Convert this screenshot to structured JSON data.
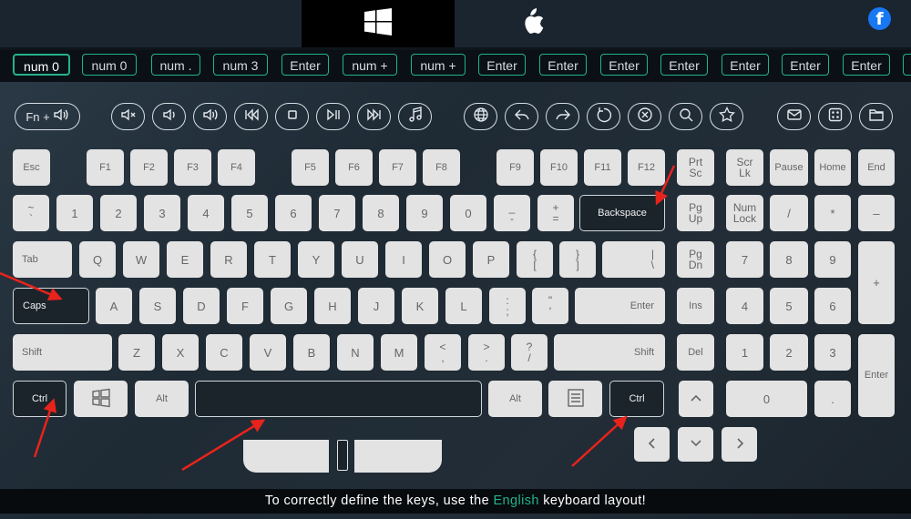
{
  "top_tabs": {
    "windows": {
      "icon": "windows-logo-icon"
    },
    "mac": {
      "icon": "apple-logo-icon"
    },
    "social": {
      "icon": "facebook-icon",
      "text": "f"
    }
  },
  "history_strip": [
    "num 0",
    "num 0",
    "num .",
    "num 3",
    "Enter",
    "num +",
    "num +",
    "Enter",
    "Enter",
    "Enter",
    "Enter",
    "Enter",
    "Enter",
    "Enter"
  ],
  "media_buttons": [
    {
      "name": "fn-volume-button",
      "icon": "speaker-icon",
      "label": "Fn +"
    },
    {
      "name": "mute-button",
      "icon": "mute-icon"
    },
    {
      "name": "volume-down-button",
      "icon": "volume-down-icon"
    },
    {
      "name": "volume-up-button",
      "icon": "volume-up-icon"
    },
    {
      "name": "previous-track-button",
      "icon": "previous-track-icon"
    },
    {
      "name": "stop-button",
      "icon": "stop-icon"
    },
    {
      "name": "play-pause-button",
      "icon": "play-pause-icon"
    },
    {
      "name": "next-track-button",
      "icon": "next-track-icon"
    },
    {
      "name": "music-button",
      "icon": "music-note-icon"
    },
    {
      "name": "browser-home-button",
      "icon": "globe-icon"
    },
    {
      "name": "browser-back-button",
      "icon": "back-arrow-icon"
    },
    {
      "name": "browser-forward-button",
      "icon": "forward-arrow-icon"
    },
    {
      "name": "refresh-button",
      "icon": "refresh-icon"
    },
    {
      "name": "browser-stop-button",
      "icon": "close-circle-icon"
    },
    {
      "name": "search-button",
      "icon": "search-icon"
    },
    {
      "name": "favorites-button",
      "icon": "star-icon"
    },
    {
      "name": "mail-button",
      "icon": "mail-icon"
    },
    {
      "name": "calculator-button",
      "icon": "calculator-icon"
    },
    {
      "name": "my-computer-button",
      "icon": "folder-icon"
    }
  ],
  "keys": {
    "esc": "Esc",
    "f1": "F1",
    "f2": "F2",
    "f3": "F3",
    "f4": "F4",
    "f5": "F5",
    "f6": "F6",
    "f7": "F7",
    "f8": "F8",
    "f9": "F9",
    "f10": "F10",
    "f11": "F11",
    "f12": "F12",
    "prtsc": [
      "Prt",
      "Sc"
    ],
    "scrlk": [
      "Scr",
      "Lk"
    ],
    "pause": "Pause",
    "home": "Home",
    "end": "End",
    "tilde": [
      "~",
      "`"
    ],
    "d1": "1",
    "d2": "2",
    "d3": "3",
    "d4": "4",
    "d5": "5",
    "d6": "6",
    "d7": "7",
    "d8": "8",
    "d9": "9",
    "d0": "0",
    "minus": [
      "_",
      "-"
    ],
    "equals": [
      "+",
      "="
    ],
    "backspace": "Backspace",
    "pgup": [
      "Pg",
      "Up"
    ],
    "numlock": [
      "Num",
      "Lock"
    ],
    "numdiv": "/",
    "nummul": "*",
    "numsub": "–",
    "tab": "Tab",
    "q": "Q",
    "w": "W",
    "e": "E",
    "r": "R",
    "t": "T",
    "y": "Y",
    "u": "U",
    "i": "I",
    "o": "O",
    "p": "P",
    "lbracket": [
      "{",
      "["
    ],
    "rbracket": [
      "}",
      "]"
    ],
    "backslash": [
      "|",
      "\\"
    ],
    "pgdn": [
      "Pg",
      "Dn"
    ],
    "num7": "7",
    "num8": "8",
    "num9": "9",
    "numadd": "+",
    "caps": "Caps",
    "a": "A",
    "s": "S",
    "d": "D",
    "f": "F",
    "g": "G",
    "h": "H",
    "j": "J",
    "k": "K",
    "l": "L",
    "semicolon": [
      ":",
      ";"
    ],
    "quote": [
      "\"",
      "'"
    ],
    "enter": "Enter",
    "ins": "Ins",
    "num4": "4",
    "num5": "5",
    "num6": "6",
    "lshift": "Shift",
    "z": "Z",
    "x": "X",
    "c": "C",
    "v": "V",
    "b": "B",
    "n": "N",
    "m": "M",
    "comma": [
      "<",
      ","
    ],
    "period": [
      ">",
      "."
    ],
    "slash": [
      "?",
      "/"
    ],
    "rshift": "Shift",
    "del": "Del",
    "num1": "1",
    "num2": "2",
    "num3": "3",
    "numenter": "Enter",
    "lctrl": "Ctrl",
    "lwin": "",
    "lalt": "Alt",
    "space": "",
    "ralt": "Alt",
    "menu": "",
    "rctrl": "Ctrl",
    "num0": "0",
    "numdot": "."
  },
  "footer": {
    "prefix": "To correctly define the keys, use the ",
    "highlight": "English",
    "suffix": " keyboard layout!"
  },
  "colors": {
    "accent": "#24b38a",
    "key": "#e3e3e3",
    "pressed": "#1c242b",
    "arrow": "#e8231c"
  }
}
